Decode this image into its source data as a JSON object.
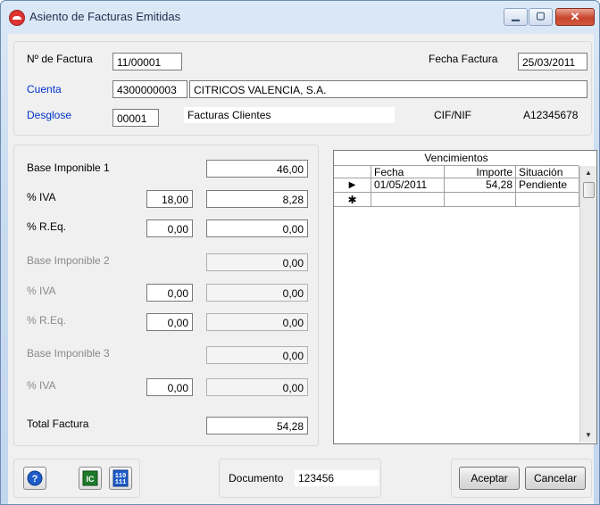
{
  "window": {
    "title": "Asiento de Facturas Emitidas"
  },
  "header": {
    "factura_label": "Nº de Factura",
    "factura_value": "11/00001",
    "fecha_label": "Fecha Factura",
    "fecha_value": "25/03/2011",
    "cuenta_label": "Cuenta",
    "cuenta_value": "4300000003",
    "cuenta_name": "CITRICOS VALENCIA, S.A.",
    "desglose_label": "Desglose",
    "desglose_value": "00001",
    "desglose_name": "Facturas Clientes",
    "cif_label": "CIF/NIF",
    "cif_value": "A12345678"
  },
  "bases": {
    "b1_label": "Base Imponible 1",
    "b1_value": "46,00",
    "iva1_label": "% IVA",
    "iva1_pct": "18,00",
    "iva1_value": "8,28",
    "req1_label": "% R.Eq.",
    "req1_pct": "0,00",
    "req1_value": "0,00",
    "b2_label": "Base Imponible 2",
    "b2_value": "0,00",
    "iva2_label": "% IVA",
    "iva2_pct": "0,00",
    "iva2_value": "0,00",
    "req2_label": "% R.Eq.",
    "req2_pct": "0,00",
    "req2_value": "0,00",
    "b3_label": "Base Imponible 3",
    "b3_value": "0,00",
    "iva3_label": "% IVA",
    "iva3_pct": "0,00",
    "iva3_value": "0,00",
    "total_label": "Total Factura",
    "total_value": "54,28"
  },
  "vencimientos": {
    "caption": "Vencimientos",
    "columns": [
      "Fecha",
      "Importe",
      "Situación"
    ],
    "rows": [
      {
        "fecha": "01/05/2011",
        "importe": "54,28",
        "situacion": "Pendiente"
      }
    ],
    "current_row_marker": "▶",
    "new_row_marker": "✱"
  },
  "footer": {
    "documento_label": "Documento",
    "documento_value": "123456",
    "aceptar_label": "Aceptar",
    "cancelar_label": "Cancelar",
    "icons": [
      "help-icon",
      "ic-icon",
      "binary-icon"
    ]
  },
  "colors": {
    "link": "#0033cc",
    "close": "#c7452d",
    "help": "#1e5cc8",
    "ic": "#1d7a2a"
  }
}
